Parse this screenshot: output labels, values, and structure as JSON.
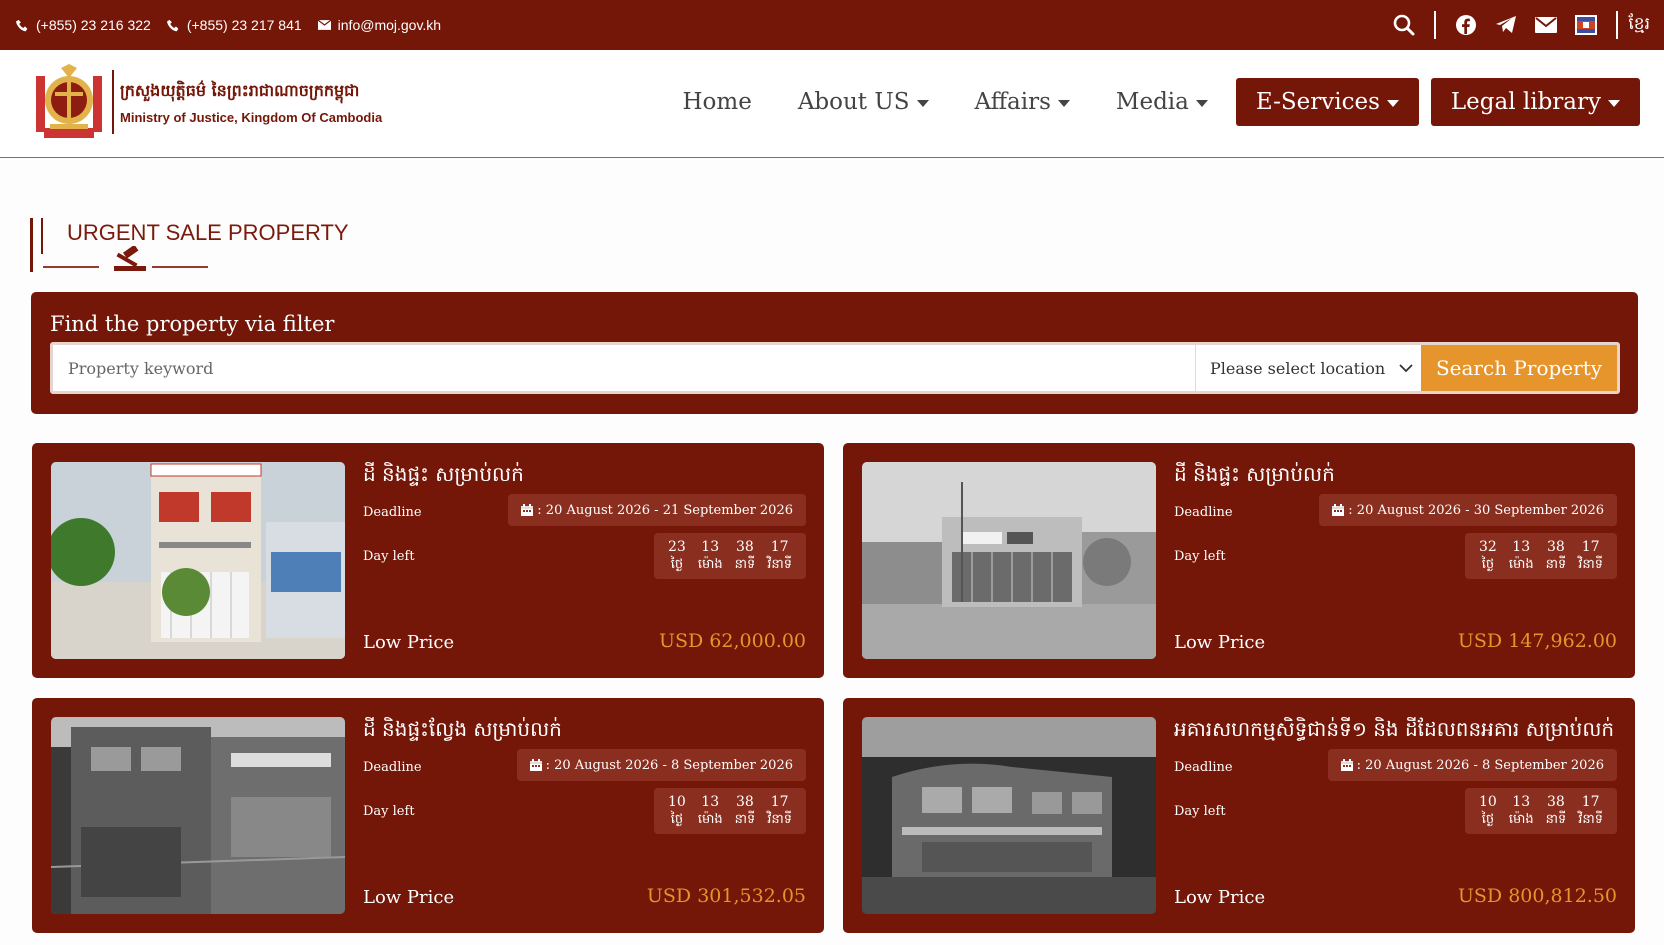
{
  "topbar": {
    "phone1": "(+855) 23 216 322",
    "phone2": "(+855) 23 217 841",
    "email": "info@moj.gov.kh",
    "language": "ខ្មែរ",
    "icons": [
      "search-icon",
      "facebook-icon",
      "telegram-icon",
      "mail-icon",
      "flag-icon"
    ]
  },
  "header": {
    "logo_khmer": "ក្រសួងយុត្តិធម៌ នៃព្រះរាជាណាចក្រកម្ពុជា",
    "logo_english": "Ministry of Justice, Kingdom Of Cambodia",
    "nav": {
      "home": "Home",
      "about": "About US",
      "affairs": "Affairs",
      "media": "Media",
      "eservices": "E-Services",
      "legal": "Legal library"
    }
  },
  "section": {
    "title": "URGENT SALE PROPERTY"
  },
  "filter": {
    "title": "Find the property via filter",
    "keyword_placeholder": "Property keyword",
    "location_placeholder": "Please select location",
    "search_label": "Search Property"
  },
  "labels": {
    "deadline": "Deadline",
    "day_left": "Day left",
    "low_price": "Low Price",
    "unit_days": "ថ្ងៃ",
    "unit_hours": "ម៉ោង",
    "unit_minutes": "នាទី",
    "unit_seconds": "វិនាទី"
  },
  "properties": [
    {
      "title": "ដី និងផ្ទះ សម្រាប់លក់",
      "deadline": ": 20 August 2026 - 21 September 2026",
      "days": "23",
      "hours": "13",
      "minutes": "38",
      "seconds": "17",
      "price": "USD 62,000.00"
    },
    {
      "title": "ដី និងផ្ទះ សម្រាប់លក់",
      "deadline": ": 20 August 2026 - 30 September 2026",
      "days": "32",
      "hours": "13",
      "minutes": "38",
      "seconds": "17",
      "price": "USD 147,962.00"
    },
    {
      "title": "ដី និងផ្ទះល្វែង សម្រាប់លក់",
      "deadline": ": 20 August 2026 - 8 September 2026",
      "days": "10",
      "hours": "13",
      "minutes": "38",
      "seconds": "17",
      "price": "USD 301,532.05"
    },
    {
      "title": "អគារសហកម្មសិទ្ធិជាន់ទី១ និង ដីដែលពនអគារ សម្រាប់លក់",
      "deadline": ": 20 August 2026 - 8 September 2026",
      "days": "10",
      "hours": "13",
      "minutes": "38",
      "seconds": "17",
      "price": "USD 800,812.50"
    }
  ],
  "colors": {
    "maroon": "#741608",
    "orange": "#e6952c"
  }
}
